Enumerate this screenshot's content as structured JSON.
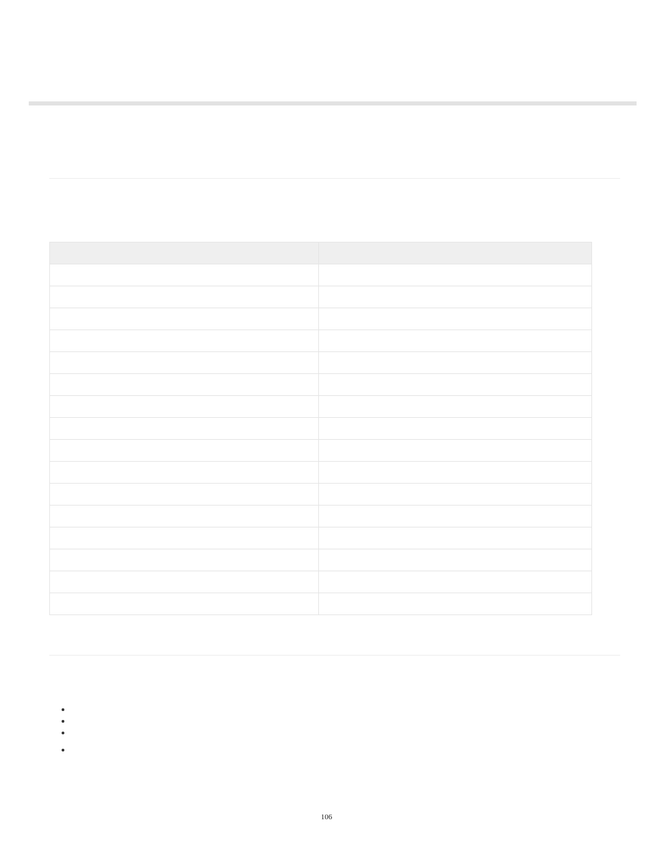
{
  "page_number": "106",
  "table": {
    "headers": [
      "",
      ""
    ],
    "rows": [
      [
        "",
        ""
      ],
      [
        "",
        ""
      ],
      [
        "",
        ""
      ],
      [
        "",
        ""
      ],
      [
        "",
        ""
      ],
      [
        "",
        ""
      ],
      [
        "",
        ""
      ],
      [
        "",
        ""
      ],
      [
        "",
        ""
      ],
      [
        "",
        ""
      ],
      [
        "",
        ""
      ],
      [
        "",
        ""
      ],
      [
        "",
        ""
      ],
      [
        "",
        ""
      ],
      [
        "",
        ""
      ],
      [
        "",
        ""
      ]
    ]
  },
  "bullets": [
    "",
    "",
    "",
    ""
  ]
}
